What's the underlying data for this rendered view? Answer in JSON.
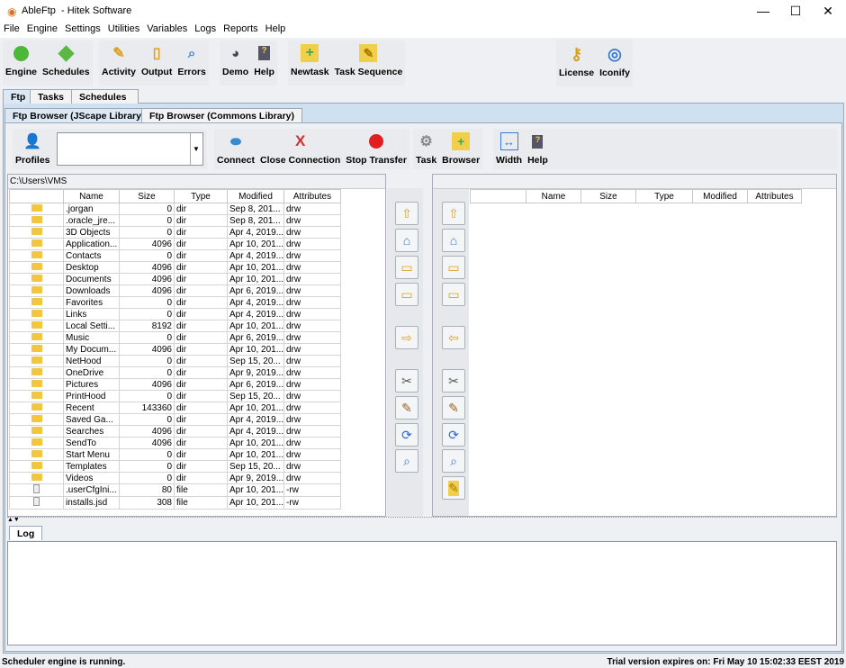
{
  "window": {
    "app": "AbleFtp",
    "vendor": "- Hitek Software",
    "minimize": "—",
    "maximize": "☐",
    "close": "✕"
  },
  "menu": [
    "File",
    "Engine",
    "Settings",
    "Utilities",
    "Variables",
    "Logs",
    "Reports",
    "Help"
  ],
  "toolbar": {
    "engine": "Engine",
    "schedules": "Schedules",
    "activity": "Activity",
    "output": "Output",
    "errors": "Errors",
    "demo": "Demo",
    "help": "Help",
    "newtask": "Newtask",
    "task_sequence": "Task Sequence",
    "license": "License",
    "iconify": "Iconify"
  },
  "tabs": [
    "Ftp",
    "Tasks",
    "Schedules"
  ],
  "subtabs": [
    "Ftp Browser (JScape Library)",
    "Ftp Browser (Commons Library)"
  ],
  "ftp_toolbar": {
    "profiles": "Profiles",
    "profile_value": "",
    "connect": "Connect",
    "close_connection": "Close Connection",
    "stop_transfer": "Stop Transfer",
    "task": "Task",
    "browser": "Browser",
    "width": "Width",
    "help": "Help"
  },
  "local": {
    "path": "C:\\Users\\VMS",
    "columns": [
      "",
      "Name",
      "Size",
      "Type",
      "Modified",
      "Attributes"
    ],
    "rows": [
      [
        "dir",
        ".jorgan",
        "0",
        "dir",
        "Sep 8, 201...",
        "drw"
      ],
      [
        "dir",
        ".oracle_jre...",
        "0",
        "dir",
        "Sep 8, 201...",
        "drw"
      ],
      [
        "dir",
        "3D Objects",
        "0",
        "dir",
        "Apr 4, 2019...",
        "drw"
      ],
      [
        "dir",
        "Application...",
        "4096",
        "dir",
        "Apr 10, 201...",
        "drw"
      ],
      [
        "dir",
        "Contacts",
        "0",
        "dir",
        "Apr 4, 2019...",
        "drw"
      ],
      [
        "dir",
        "Desktop",
        "4096",
        "dir",
        "Apr 10, 201...",
        "drw"
      ],
      [
        "dir",
        "Documents",
        "4096",
        "dir",
        "Apr 10, 201...",
        "drw"
      ],
      [
        "dir",
        "Downloads",
        "4096",
        "dir",
        "Apr 6, 2019...",
        "drw"
      ],
      [
        "dir",
        "Favorites",
        "0",
        "dir",
        "Apr 4, 2019...",
        "drw"
      ],
      [
        "dir",
        "Links",
        "0",
        "dir",
        "Apr 4, 2019...",
        "drw"
      ],
      [
        "dir",
        "Local Setti...",
        "8192",
        "dir",
        "Apr 10, 201...",
        "drw"
      ],
      [
        "dir",
        "Music",
        "0",
        "dir",
        "Apr 6, 2019...",
        "drw"
      ],
      [
        "dir",
        "My Docum...",
        "4096",
        "dir",
        "Apr 10, 201...",
        "drw"
      ],
      [
        "dir",
        "NetHood",
        "0",
        "dir",
        "Sep 15, 20...",
        "drw"
      ],
      [
        "dir",
        "OneDrive",
        "0",
        "dir",
        "Apr 9, 2019...",
        "drw"
      ],
      [
        "dir",
        "Pictures",
        "4096",
        "dir",
        "Apr 6, 2019...",
        "drw"
      ],
      [
        "dir",
        "PrintHood",
        "0",
        "dir",
        "Sep 15, 20...",
        "drw"
      ],
      [
        "dir",
        "Recent",
        "143360",
        "dir",
        "Apr 10, 201...",
        "drw"
      ],
      [
        "dir",
        "Saved Ga...",
        "0",
        "dir",
        "Apr 4, 2019...",
        "drw"
      ],
      [
        "dir",
        "Searches",
        "4096",
        "dir",
        "Apr 4, 2019...",
        "drw"
      ],
      [
        "dir",
        "SendTo",
        "4096",
        "dir",
        "Apr 10, 201...",
        "drw"
      ],
      [
        "dir",
        "Start Menu",
        "0",
        "dir",
        "Apr 10, 201...",
        "drw"
      ],
      [
        "dir",
        "Templates",
        "0",
        "dir",
        "Sep 15, 20...",
        "drw"
      ],
      [
        "dir",
        "Videos",
        "0",
        "dir",
        "Apr 9, 2019...",
        "drw"
      ],
      [
        "file",
        ".userCfgIni...",
        "80",
        "file",
        "Apr 10, 201...",
        "-rw"
      ],
      [
        "file",
        "installs.jsd",
        "308",
        "file",
        "Apr 10, 201...",
        "-rw"
      ]
    ]
  },
  "remote": {
    "columns": [
      "",
      "Name",
      "Size",
      "Type",
      "Modified",
      "Attributes"
    ]
  },
  "log": {
    "tab": "Log"
  },
  "status": {
    "left": "Scheduler engine is running.",
    "right": "Trial version expires on: Fri May 10 15:02:33 EEST 2019"
  }
}
